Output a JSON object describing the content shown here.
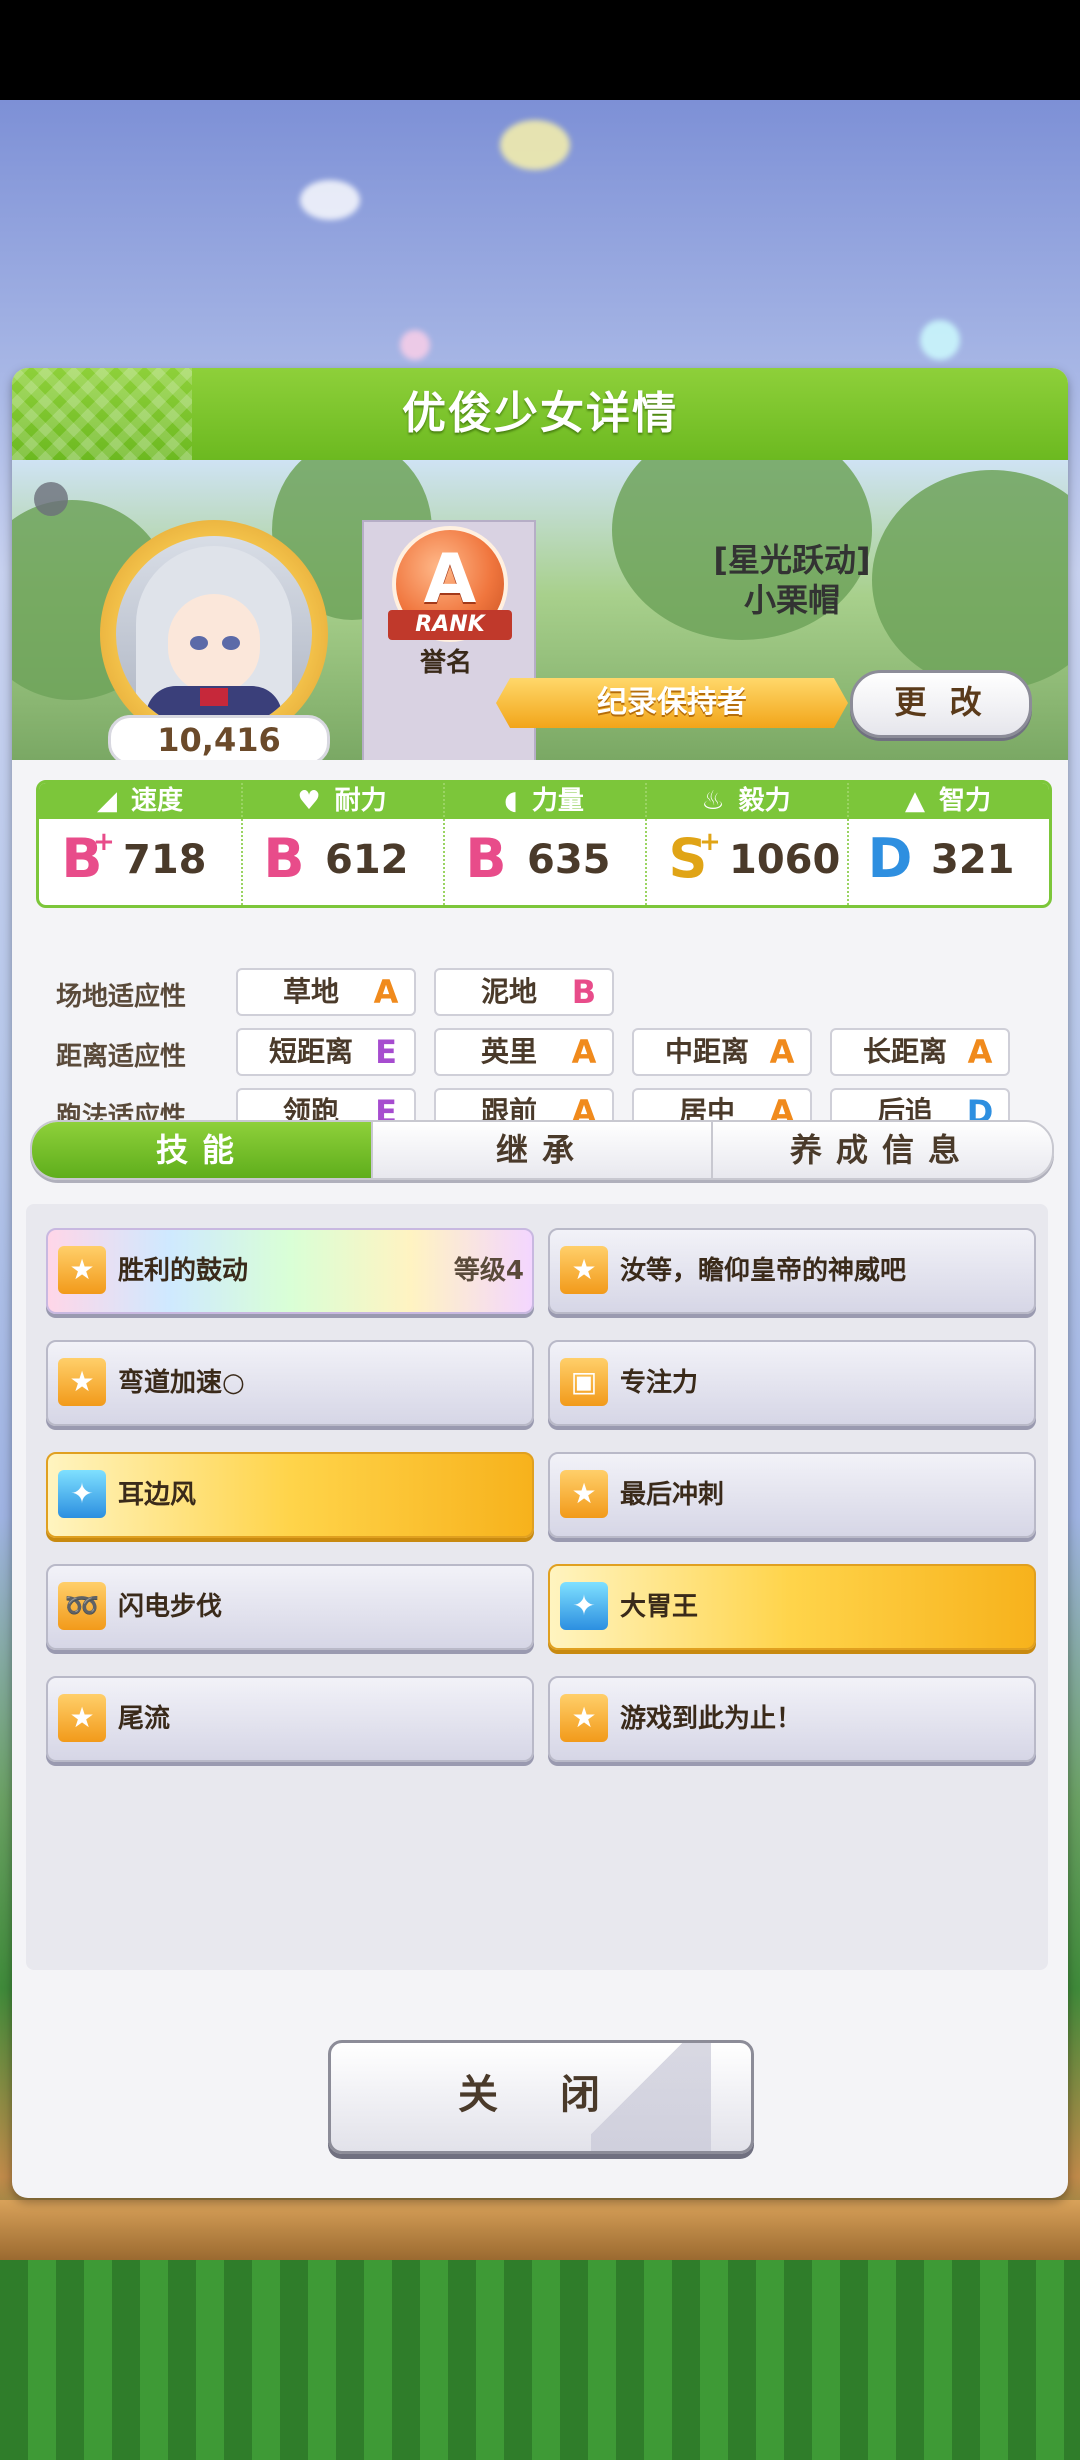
{
  "header": {
    "title": "优俊少女详情"
  },
  "profile": {
    "score": "10,416",
    "rank_letter": "A",
    "rank_ribbon": "RANK",
    "rank_sub": "誉名",
    "epithet_line1": "[星光跃动]",
    "epithet_line2": "小栗帽",
    "title_banner": "纪录保持者",
    "change_button": "更 改"
  },
  "stats": [
    {
      "label": "速度",
      "icon": "shoe-icon",
      "grade": "B",
      "plus": "+",
      "value": "718",
      "grade_color": "#e84c8a"
    },
    {
      "label": "耐力",
      "icon": "heart-icon",
      "grade": "B",
      "plus": "",
      "value": "612",
      "grade_color": "#e84c8a"
    },
    {
      "label": "力量",
      "icon": "muscle-icon",
      "grade": "B",
      "plus": "",
      "value": "635",
      "grade_color": "#e84c8a"
    },
    {
      "label": "毅力",
      "icon": "flame-icon",
      "grade": "S",
      "plus": "+",
      "value": "1060",
      "grade_color": "#e0a416"
    },
    {
      "label": "智力",
      "icon": "grad-cap-icon",
      "grade": "D",
      "plus": "",
      "value": "321",
      "grade_color": "#2e8fe0"
    }
  ],
  "aptitude": {
    "rows": [
      {
        "label": "场地适应性",
        "items": [
          {
            "name": "草地",
            "grade": "A"
          },
          {
            "name": "泥地",
            "grade": "B"
          }
        ]
      },
      {
        "label": "距离适应性",
        "items": [
          {
            "name": "短距离",
            "grade": "E"
          },
          {
            "name": "英里",
            "grade": "A"
          },
          {
            "name": "中距离",
            "grade": "A"
          },
          {
            "name": "长距离",
            "grade": "A"
          }
        ]
      },
      {
        "label": "跑法适应性",
        "items": [
          {
            "name": "领跑",
            "grade": "E"
          },
          {
            "name": "跟前",
            "grade": "A"
          },
          {
            "name": "居中",
            "grade": "A"
          },
          {
            "name": "后追",
            "grade": "D"
          }
        ]
      }
    ],
    "grade_colors": {
      "A": "#f08a1c",
      "B": "#e84c8a",
      "D": "#2e8fe0",
      "E": "#a64ccf"
    }
  },
  "tabs": [
    "技能",
    "继承",
    "养成信息"
  ],
  "skills": [
    {
      "name": "胜利的鼓动",
      "level": "等级4",
      "style": "rainbow",
      "icon": "runner-icon"
    },
    {
      "name": "汝等，瞻仰皇帝的神威吧",
      "level": "",
      "style": "normal",
      "icon": "runner-icon"
    },
    {
      "name": "弯道加速○",
      "level": "",
      "style": "normal",
      "icon": "runner-icon"
    },
    {
      "name": "专注力",
      "level": "",
      "style": "normal",
      "icon": "gate-icon"
    },
    {
      "name": "耳边风",
      "level": "",
      "style": "gold",
      "icon": "sparkle-icon"
    },
    {
      "name": "最后冲刺",
      "level": "",
      "style": "normal",
      "icon": "runner-icon"
    },
    {
      "name": "闪电步伐",
      "level": "",
      "style": "normal",
      "icon": "curve-icon"
    },
    {
      "name": "大胃王",
      "level": "",
      "style": "gold",
      "icon": "sparkle-icon"
    },
    {
      "name": "尾流",
      "level": "",
      "style": "normal",
      "icon": "runner-icon"
    },
    {
      "name": "游戏到此为止！",
      "level": "",
      "style": "normal",
      "icon": "runner-icon"
    }
  ],
  "close_button": "关 闭"
}
